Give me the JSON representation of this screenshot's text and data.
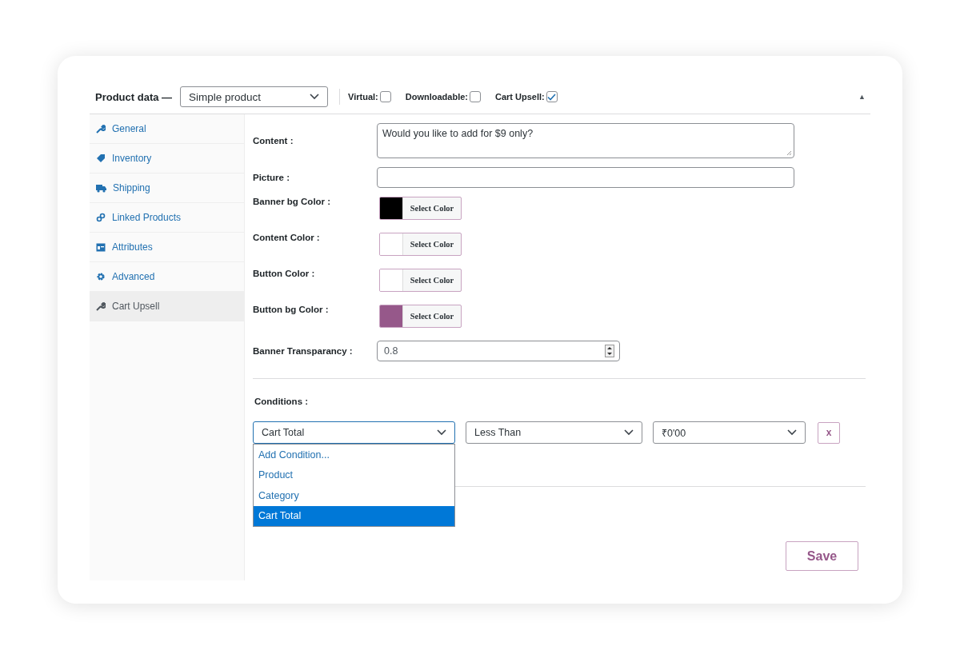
{
  "header": {
    "title": "Product data —",
    "product_type": "Simple product",
    "options": [
      {
        "label": "Virtual:",
        "checked": false
      },
      {
        "label": "Downloadable:",
        "checked": false
      },
      {
        "label": "Cart Upsell:",
        "checked": true
      }
    ],
    "collapse": "▲"
  },
  "tabs": [
    {
      "label": "General",
      "kind": "wrench",
      "selected": false
    },
    {
      "label": "Inventory",
      "kind": "tag",
      "selected": false
    },
    {
      "label": "Shipping",
      "kind": "truck",
      "selected": false
    },
    {
      "label": "Linked Products",
      "kind": "link",
      "selected": false
    },
    {
      "label": "Attributes",
      "kind": "card",
      "selected": false
    },
    {
      "label": "Advanced",
      "kind": "gear",
      "selected": false
    },
    {
      "label": "Cart Upsell",
      "kind": "wrench",
      "selected": true
    }
  ],
  "fields": [
    {
      "kind": "textarea",
      "label": "Content :",
      "value": "Would you like to add for $9 only?"
    },
    {
      "kind": "text",
      "label": "Picture :"
    },
    {
      "kind": "color",
      "label": "Banner bg Color :",
      "color": "#000000",
      "button": "Select Color"
    },
    {
      "kind": "color",
      "label": "Content Color :",
      "color": "#ffffff",
      "button": "Select Color"
    },
    {
      "kind": "color",
      "label": "Button Color :",
      "color": "#ffffff",
      "button": "Select Color"
    },
    {
      "kind": "color",
      "label": "Button bg Color :",
      "color": "#96588a",
      "button": "Select Color"
    },
    {
      "kind": "number",
      "label": "Banner Transparancy :",
      "value": "0.8"
    }
  ],
  "conditions": {
    "label": "Conditions :",
    "selects": [
      {
        "value": "Cart Total",
        "open": true
      },
      {
        "value": "Less Than",
        "open": false
      },
      {
        "value": "₹0'00",
        "open": false
      }
    ],
    "options": [
      {
        "label": "Add Condition...",
        "selected": false
      },
      {
        "label": "Product",
        "selected": false
      },
      {
        "label": "Category",
        "selected": false
      },
      {
        "label": "Cart Total",
        "selected": true
      }
    ],
    "remove": "x"
  },
  "save": "Save"
}
